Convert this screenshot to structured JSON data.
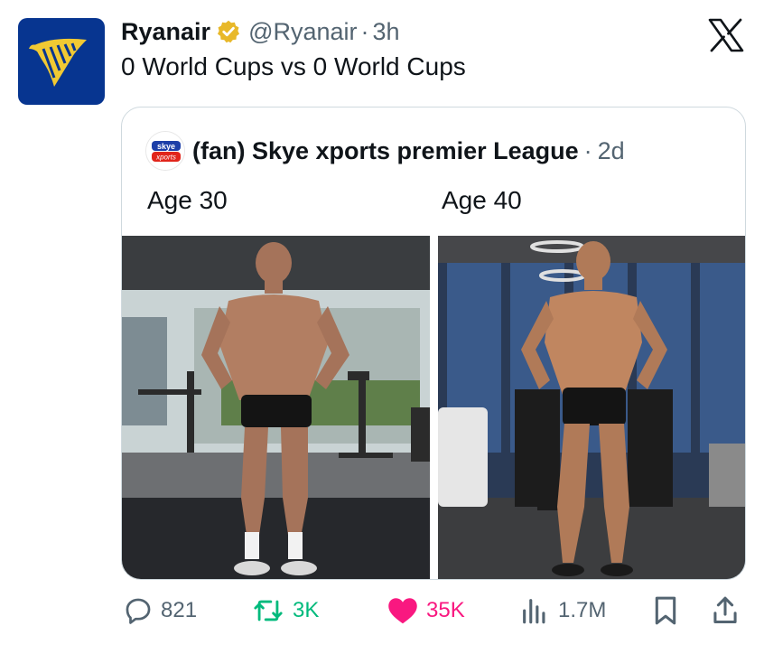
{
  "tweet": {
    "display_name": "Ryanair",
    "handle": "@Ryanair",
    "separator": "·",
    "time": "3h",
    "text": "0 World Cups vs 0 World Cups",
    "avatar_color": "#073590",
    "logo_color": "#f1c933",
    "verified_color": "#e8b829"
  },
  "quote": {
    "display_name": "(fan) Skye xports premier League",
    "separator": "·",
    "time": "2d",
    "avatar_text_top": "skye",
    "avatar_text_bottom": "xports",
    "left_caption": "Age 30",
    "right_caption": "Age 40"
  },
  "actions": {
    "replies": "821",
    "reposts": "3K",
    "likes": "35K",
    "views": "1.7M",
    "repost_color": "#00ba7c",
    "like_color": "#f91880",
    "muted_color": "#536471"
  },
  "icons": {
    "close": "x-logo-icon",
    "reply": "reply-icon",
    "repost": "repost-icon",
    "like": "heart-icon",
    "views": "views-icon",
    "bookmark": "bookmark-icon",
    "share": "share-icon",
    "verified": "verified-badge-icon"
  }
}
